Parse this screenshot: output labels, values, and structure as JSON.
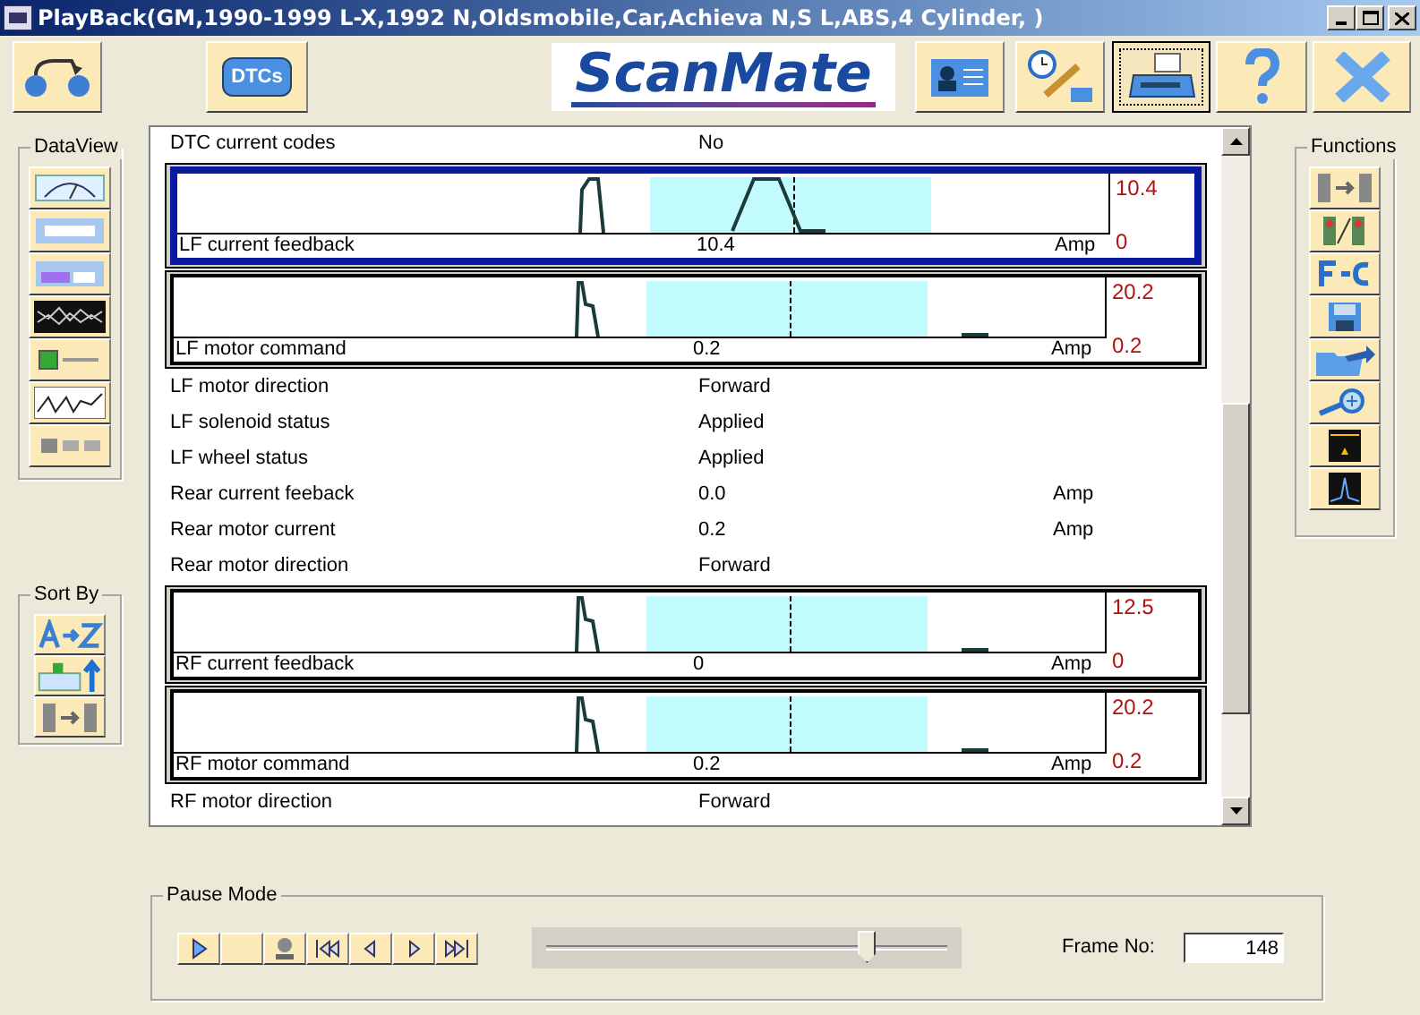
{
  "window": {
    "title": "PlayBack(GM,1990-1999 L-X,1992 N,Oldsmobile,Car,Achieva N,S L,ABS,4 Cylinder, )"
  },
  "toolbar": [
    {
      "kind": "tape",
      "selected": false
    },
    {
      "kind": "dtc",
      "label": "DTCs",
      "selected": false
    },
    {
      "kind": "logo",
      "label": "ScanMate",
      "selected": false
    },
    {
      "kind": "card",
      "selected": false
    },
    {
      "kind": "clock",
      "selected": false
    },
    {
      "kind": "printer",
      "selected": true
    },
    {
      "kind": "help",
      "selected": false
    },
    {
      "kind": "exit",
      "selected": false
    }
  ],
  "dataview": {
    "title": "DataView",
    "buttons": [
      {
        "kind": "gauge"
      },
      {
        "kind": "digital"
      },
      {
        "kind": "bar"
      },
      {
        "kind": "scope"
      },
      {
        "kind": "led"
      },
      {
        "kind": "graph"
      },
      {
        "kind": "switch"
      }
    ]
  },
  "sort_by": {
    "title": "Sort By",
    "buttons": [
      {
        "kind": "alpha"
      },
      {
        "kind": "graph-up"
      },
      {
        "kind": "swap"
      }
    ]
  },
  "functions": {
    "title": "Functions",
    "buttons": [
      {
        "kind": "swap"
      },
      {
        "kind": "traffic"
      },
      {
        "kind": "unit"
      },
      {
        "kind": "save"
      },
      {
        "kind": "folder"
      },
      {
        "kind": "zoom"
      },
      {
        "kind": "frame"
      },
      {
        "kind": "peak"
      }
    ]
  },
  "rows": [
    {
      "kind": "text",
      "name": "DTC current codes",
      "value": "No",
      "unit": ""
    },
    {
      "kind": "graph",
      "name": "LF current feedback",
      "value": "10.4",
      "unit": "Amp",
      "max": "10.4",
      "min": "0",
      "selected": true
    },
    {
      "kind": "graph",
      "name": "LF motor command",
      "value": "0.2",
      "unit": "Amp",
      "max": "20.2",
      "min": "0.2",
      "selected": false
    },
    {
      "kind": "text",
      "name": "LF motor direction",
      "value": "Forward",
      "unit": ""
    },
    {
      "kind": "text",
      "name": "LF solenoid status",
      "value": "Applied",
      "unit": ""
    },
    {
      "kind": "text",
      "name": "LF wheel status",
      "value": "Applied",
      "unit": ""
    },
    {
      "kind": "text",
      "name": "Rear current feeback",
      "value": "0.0",
      "unit": "Amp"
    },
    {
      "kind": "text",
      "name": "Rear motor current",
      "value": "0.2",
      "unit": "Amp"
    },
    {
      "kind": "text",
      "name": "Rear motor direction",
      "value": "Forward",
      "unit": ""
    },
    {
      "kind": "graph",
      "name": "RF current feedback",
      "value": "0",
      "unit": "Amp",
      "max": "12.5",
      "min": "0",
      "selected": false
    },
    {
      "kind": "graph",
      "name": "RF motor command",
      "value": "0.2",
      "unit": "Amp",
      "max": "20.2",
      "min": "0.2",
      "selected": false
    },
    {
      "kind": "text",
      "name": "RF motor direction",
      "value": "Forward",
      "unit": ""
    }
  ],
  "pause": {
    "title": "Pause Mode",
    "buttons": [
      {
        "kind": "play"
      },
      {
        "kind": "blank"
      },
      {
        "kind": "record"
      },
      {
        "kind": "first"
      },
      {
        "kind": "prev"
      },
      {
        "kind": "next"
      },
      {
        "kind": "last"
      }
    ],
    "slider": {
      "level": 0.8
    },
    "frame_label": "Frame No:",
    "frame_value": "148"
  }
}
